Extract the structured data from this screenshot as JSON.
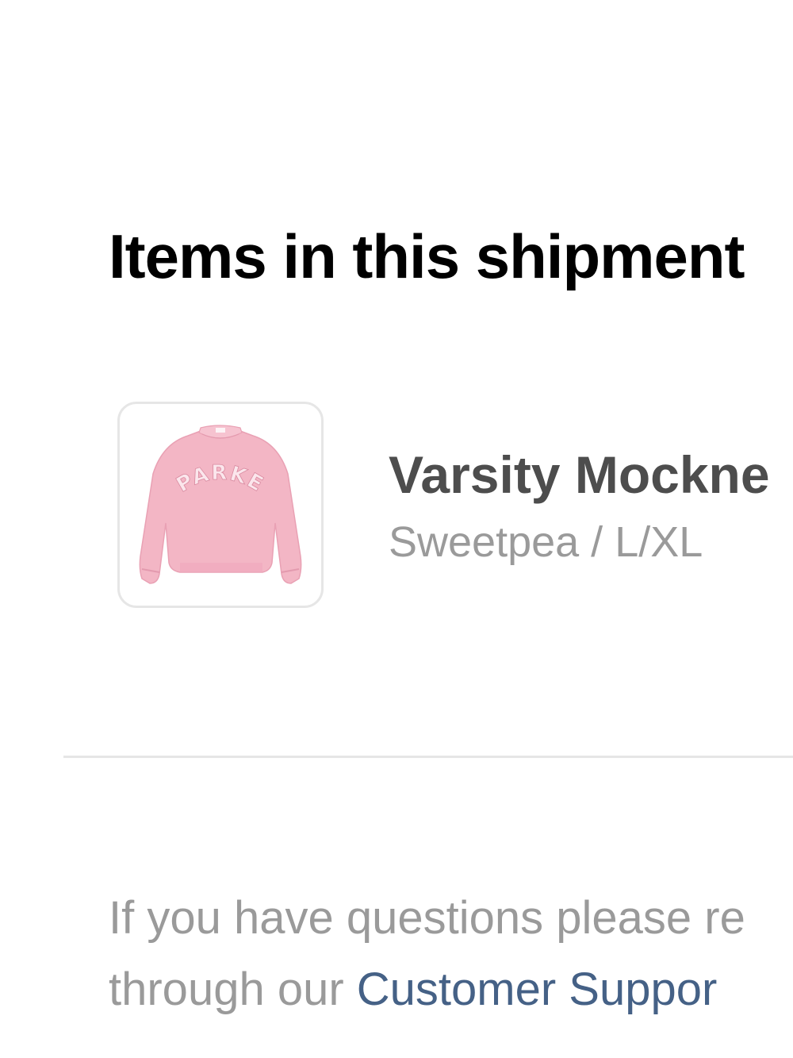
{
  "shipment": {
    "title": "Items in this shipment",
    "items": [
      {
        "name": "Varsity Mockne",
        "variant": "Sweetpea / L/XL",
        "thumbnail_icon": "pink-sweatshirt-image",
        "thumbnail_logo_text": "PARKE"
      }
    ]
  },
  "footer": {
    "line1": "If you have questions please re",
    "line2_prefix": "through our ",
    "support_link": "Customer Suppor"
  },
  "colors": {
    "title": "#000000",
    "item_name": "#4d4d4d",
    "muted_text": "#9a9a9a",
    "link": "#456186",
    "divider": "#e6e6e6",
    "sweatshirt": "#f2b3c4"
  }
}
